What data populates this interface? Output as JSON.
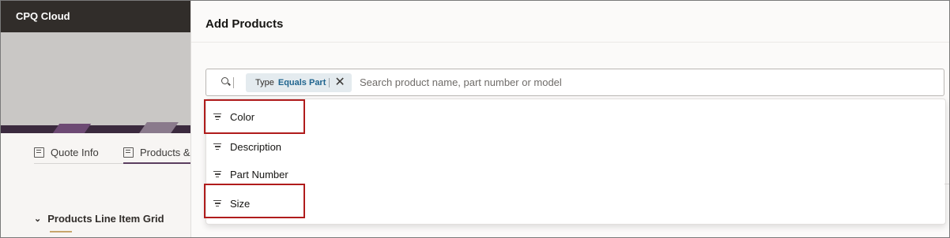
{
  "app": {
    "title": "CPQ Cloud"
  },
  "background": {
    "tabs": [
      {
        "label": "Quote Info",
        "icon": "quote-info-icon"
      },
      {
        "label": "Products &",
        "icon": "products-icon"
      }
    ],
    "grid_title": "Products Line Item Grid",
    "grid_toggle_icon": "chevron-down-icon"
  },
  "drawer": {
    "title": "Add Products",
    "search": {
      "icon": "search-icon",
      "placeholder": "Search product name, part number or model",
      "chip": {
        "field": "Type",
        "operator_value": "Equals Part",
        "remove_icon": "close-icon"
      }
    },
    "options": [
      {
        "label": "Color",
        "icon": "filter-icon"
      },
      {
        "label": "Description",
        "icon": "filter-icon"
      },
      {
        "label": "Part Number",
        "icon": "filter-icon"
      },
      {
        "label": "Size",
        "icon": "filter-icon"
      }
    ]
  },
  "colors": {
    "topbar": "#312d2a",
    "chip_bg": "#e4ebef",
    "chip_value": "#20658f",
    "highlight": "#b01c1c",
    "active_tab": "#5b3e5f"
  }
}
